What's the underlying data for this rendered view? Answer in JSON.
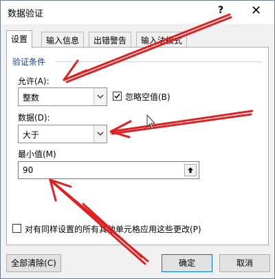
{
  "window": {
    "title": "数据验证",
    "help": "?",
    "close": "✕"
  },
  "tabs": [
    {
      "label": "设置",
      "active": true
    },
    {
      "label": "输入信息",
      "active": false
    },
    {
      "label": "出错警告",
      "active": false
    },
    {
      "label": "输入法模式",
      "active": false
    }
  ],
  "settings": {
    "group_title": "验证条件",
    "allow_label": "允许(A):",
    "allow_value": "整数",
    "ignore_blank_label": "忽略空值(B)",
    "ignore_blank_checked": true,
    "data_label": "数据(D):",
    "data_value": "大于",
    "min_label": "最小值(M)",
    "min_value": "90",
    "apply_all_label": "对有同样设置的所有其他单元格应用这些更改(P)",
    "apply_all_checked": false
  },
  "footer": {
    "clear_all": "全部清除(C)",
    "ok": "确定",
    "cancel": "取消"
  },
  "colors": {
    "accent": "#0078d7",
    "group_title": "#1b3f92",
    "annotation": "#e02020"
  }
}
